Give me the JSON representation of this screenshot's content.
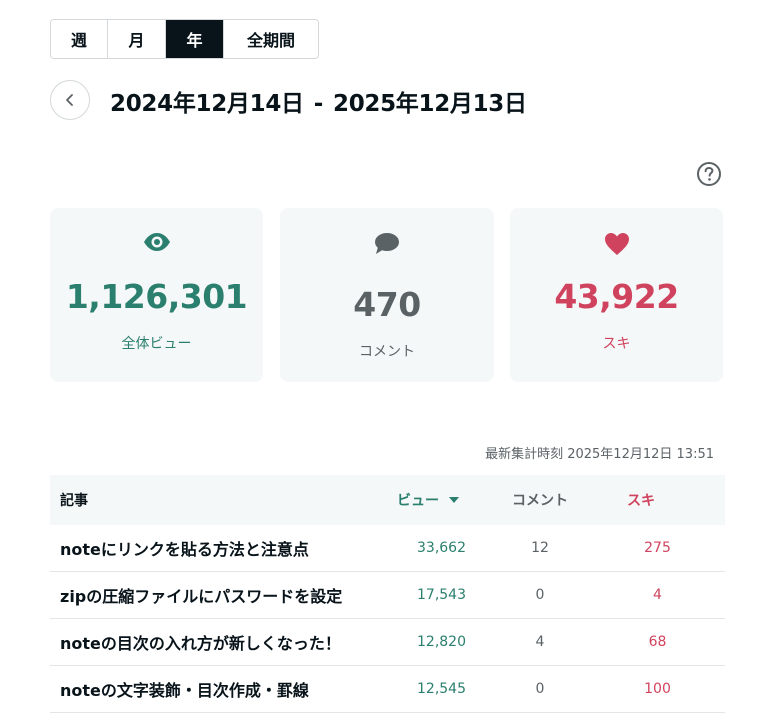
{
  "period_tabs": [
    {
      "label": "週",
      "active": false
    },
    {
      "label": "月",
      "active": false
    },
    {
      "label": "年",
      "active": true
    },
    {
      "label": "全期間",
      "active": false
    }
  ],
  "date_range": {
    "start": "2024年12月14日",
    "separator": "-",
    "end": "2025年12月13日"
  },
  "summary": {
    "views": {
      "value": "1,126,301",
      "label": "全体ビュー",
      "icon": "eye-icon",
      "color": "#2a7f6e"
    },
    "comments": {
      "value": "470",
      "label": "コメント",
      "icon": "speech-bubble-icon",
      "color": "#5b6266"
    },
    "likes": {
      "value": "43,922",
      "label": "スキ",
      "icon": "heart-icon",
      "color": "#d0435e"
    }
  },
  "updated_at": "最新集計時刻 2025年12月12日 13:51",
  "table": {
    "headers": {
      "title": "記事",
      "views": "ビュー",
      "comments": "コメント",
      "likes": "スキ"
    },
    "rows": [
      {
        "title": "noteにリンクを貼る方法と注意点",
        "views": "33,662",
        "comments": "12",
        "likes": "275"
      },
      {
        "title": "zipの圧縮ファイルにパスワードを設定",
        "views": "17,543",
        "comments": "0",
        "likes": "4"
      },
      {
        "title": "noteの目次の入れ方が新しくなった！",
        "views": "12,820",
        "comments": "4",
        "likes": "68"
      },
      {
        "title": "noteの文字装飾・目次作成・罫線",
        "views": "12,545",
        "comments": "0",
        "likes": "100"
      }
    ]
  }
}
